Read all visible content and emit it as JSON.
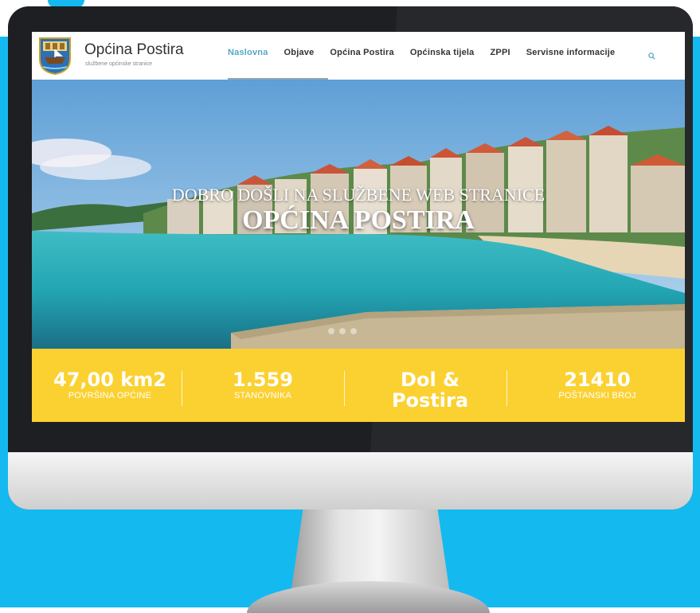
{
  "site": {
    "title": "Općina Postira",
    "subtitle": "službene općinske stranice"
  },
  "nav": {
    "items": [
      {
        "label": "Naslovna",
        "active": true
      },
      {
        "label": "Objave",
        "active": false
      },
      {
        "label": "Općina Postira",
        "active": false
      },
      {
        "label": "Općinska tijela",
        "active": false
      },
      {
        "label": "ZPPI",
        "active": false
      },
      {
        "label": "Servisne informacije",
        "active": false
      }
    ]
  },
  "hero": {
    "line1": "DOBRO DOŠLI NA SLUŽBENE WEB STRANICE",
    "line2": "OPĆINA POSTIRA"
  },
  "stats": [
    {
      "value": "47,00 km2",
      "label": "POVRŠINA OPĆINE"
    },
    {
      "value": "1.559",
      "label": "STANOVNIKA"
    },
    {
      "value": "Dol & Postira",
      "label": ""
    },
    {
      "value": "21410",
      "label": "POŠTANSKI BROJ"
    }
  ],
  "colors": {
    "background": "#14b9f0",
    "accent_nav": "#54a8c7",
    "stats_bar": "#fbd132"
  },
  "icons": {
    "search": "search-icon",
    "logo": "coat-of-arms-icon"
  }
}
